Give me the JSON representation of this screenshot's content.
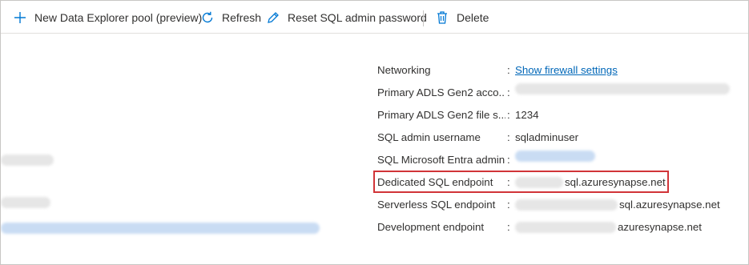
{
  "toolbar": {
    "new_pool": {
      "label": "New Data Explorer pool (preview)",
      "icon": "plus-icon"
    },
    "refresh": {
      "label": "Refresh",
      "icon": "refresh-icon"
    },
    "reset_password": {
      "label": "Reset SQL admin password",
      "icon": "pencil-icon"
    },
    "delete": {
      "label": "Delete",
      "icon": "trash-icon"
    }
  },
  "properties": {
    "networking": {
      "label": "Networking",
      "value": "Show firewall settings"
    },
    "primary_adls_account": {
      "label": "Primary ADLS Gen2 acco...",
      "value": ""
    },
    "primary_adls_file": {
      "label": "Primary ADLS Gen2 file s...",
      "value": "1234"
    },
    "sql_admin_username": {
      "label": "SQL admin username",
      "value": "sqladminuser"
    },
    "sql_entra_admin": {
      "label": "SQL Microsoft Entra admin",
      "value": ""
    },
    "dedicated_sql_endpoint": {
      "label": "Dedicated SQL endpoint",
      "value_suffix": "sql.azuresynapse.net"
    },
    "serverless_sql_endpoint": {
      "label": "Serverless SQL endpoint",
      "value_suffix": "sql.azuresynapse.net"
    },
    "development_endpoint": {
      "label": "Development endpoint",
      "value_suffix": "azuresynapse.net"
    }
  },
  "separator": ":",
  "colors": {
    "accent": "#0067b8",
    "highlight": "#d13438"
  }
}
